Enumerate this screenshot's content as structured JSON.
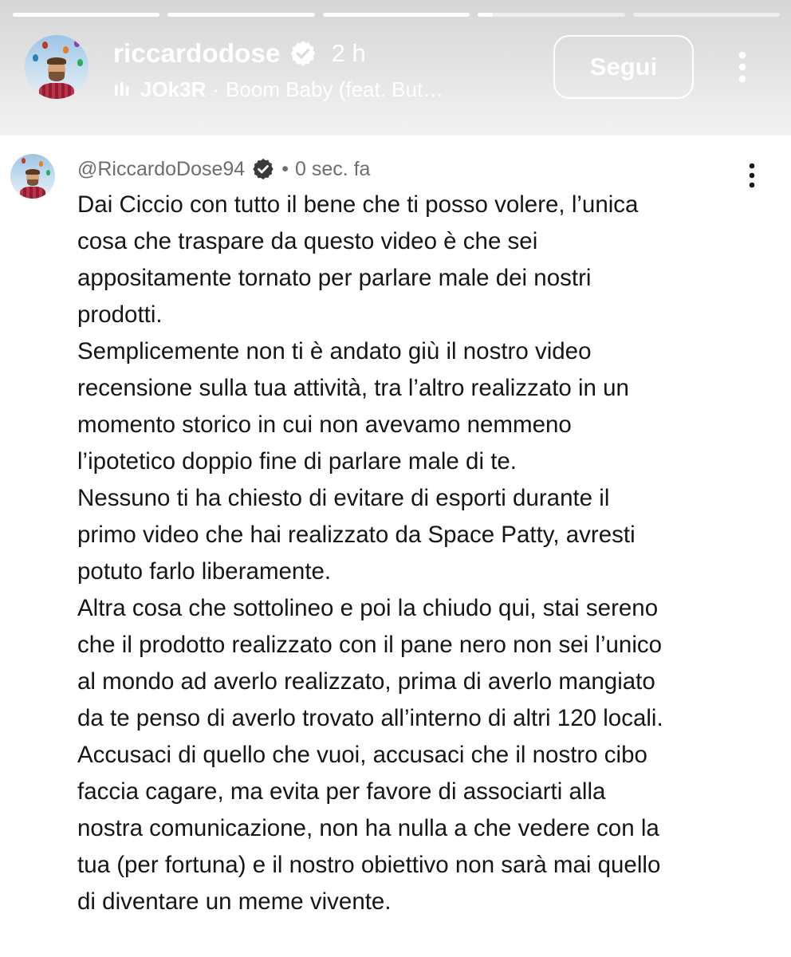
{
  "story": {
    "progress": [
      1.0,
      1.0,
      1.0,
      0.1,
      0.0
    ],
    "username": "riccardodose",
    "time_ago": "2 h",
    "music": {
      "artist": "JOk3R",
      "separator": "·",
      "song": "Boom Baby (feat. But…"
    },
    "follow_label": "Segui"
  },
  "comment": {
    "handle": "@RiccardoDose94",
    "separator": "•",
    "time": "0 sec. fa",
    "lines": [
      "Dai Ciccio con tutto il bene che ti posso volere, l’unica",
      "cosa che traspare da questo video è che sei",
      "appositamente tornato per parlare male dei nostri",
      "prodotti.",
      "Semplicemente non ti è andato giù il nostro video",
      "recensione sulla tua attività, tra l’altro realizzato in un",
      "momento storico in cui non avevamo nemmeno",
      "l’ipotetico doppio fine di parlare male di te.",
      "Nessuno ti ha chiesto di evitare di esporti durante il",
      "primo video che hai realizzato da Space Patty, avresti",
      "potuto farlo liberamente.",
      "Altra cosa che sottolineo e poi la chiudo qui, stai sereno",
      "che il prodotto realizzato con il pane nero non sei l’unico",
      "al mondo ad averlo realizzato, prima di averlo mangiato",
      "da te penso di averlo trovato all’interno di altri 120 locali.",
      "Accusaci di quello che vuoi, accusaci che il nostro cibo",
      "faccia cagare, ma evita per favore di associarti alla",
      "nostra comunicazione, non ha nulla a che vedere con la",
      "tua (per fortuna) e il nostro obiettivo non sarà mai quello",
      "di diventare un meme vivente."
    ]
  },
  "icons": {
    "verified": "verified-badge-icon",
    "music": "music-bars-icon",
    "more": "more-vertical-icon"
  },
  "colors": {
    "header_bg": "#e2e2e2",
    "text": "#161616",
    "meta_text": "#6e6e6e",
    "white": "#ffffff"
  }
}
